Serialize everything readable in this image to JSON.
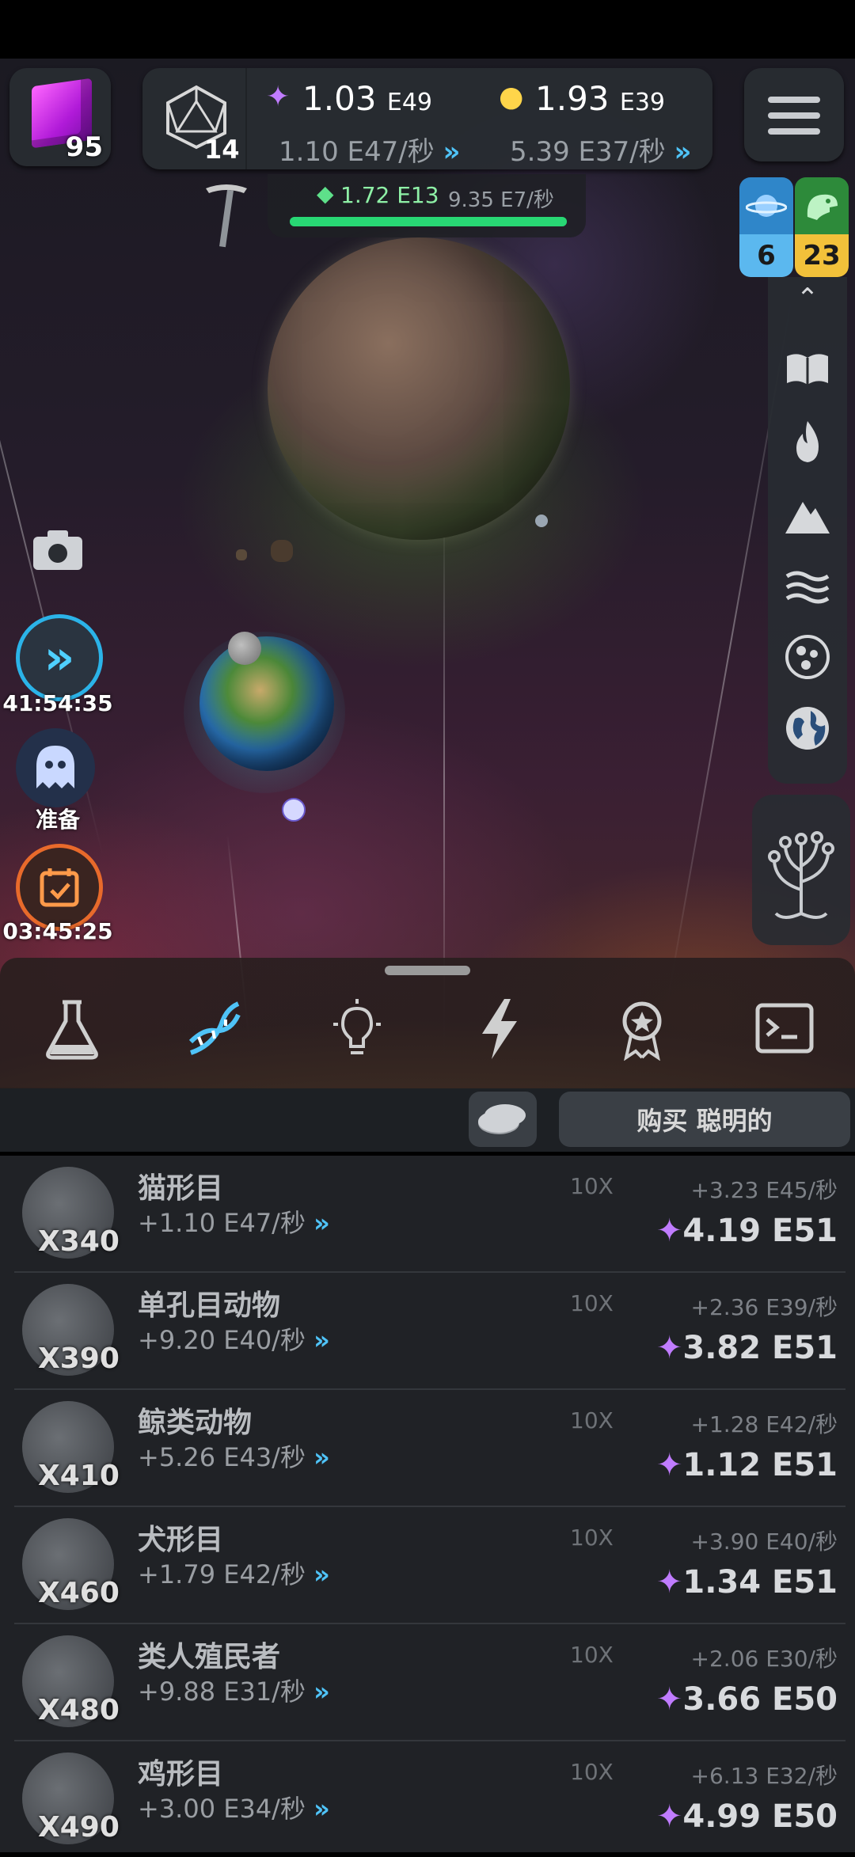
{
  "hud": {
    "cube_count": "95",
    "level": "14",
    "resource1_value": "1.03",
    "resource1_exp": "E49",
    "resource1_rate": "1.10 E47/秒",
    "resource2_value": "1.93",
    "resource2_exp": "E39",
    "resource2_rate": "5.39 E37/秒",
    "gem_value": "1.72 E13",
    "gem_rate": "9.35 E7/秒",
    "gem_progress": 1.0
  },
  "badges": {
    "planets": "6",
    "dinos": "23"
  },
  "timers": {
    "boost": "41:54:35",
    "ghost": "准备",
    "calendar": "03:45:25"
  },
  "buy_label": "购买 聪明的",
  "items": [
    {
      "name": "猫形目",
      "count": "X340",
      "income": "+1.10 E47/秒",
      "mult": "10X",
      "gain": "+3.23 E45/秒",
      "cost": "4.19 E51"
    },
    {
      "name": "单孔目动物",
      "count": "X390",
      "income": "+9.20 E40/秒",
      "mult": "10X",
      "gain": "+2.36 E39/秒",
      "cost": "3.82 E51"
    },
    {
      "name": "鲸类动物",
      "count": "X410",
      "income": "+5.26 E43/秒",
      "mult": "10X",
      "gain": "+1.28 E42/秒",
      "cost": "1.12 E51"
    },
    {
      "name": "犬形目",
      "count": "X460",
      "income": "+1.79 E42/秒",
      "mult": "10X",
      "gain": "+3.90 E40/秒",
      "cost": "1.34 E51"
    },
    {
      "name": "类人殖民者",
      "count": "X480",
      "income": "+9.88 E31/秒",
      "mult": "10X",
      "gain": "+2.06 E30/秒",
      "cost": "3.66 E50"
    },
    {
      "name": "鸡形目",
      "count": "X490",
      "income": "+3.00 E34/秒",
      "mult": "10X",
      "gain": "+6.13 E32/秒",
      "cost": "4.99 E50"
    }
  ]
}
